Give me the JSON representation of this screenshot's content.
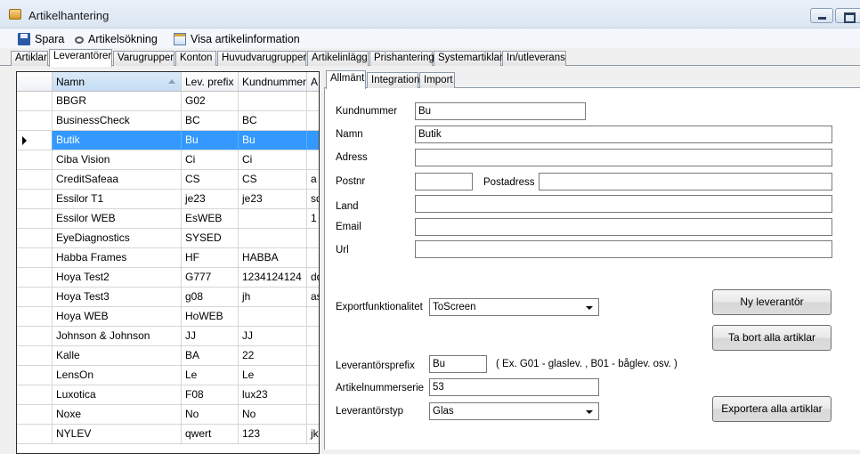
{
  "window": {
    "title": "Artikelhantering"
  },
  "toolbar": {
    "save_label": "Spara",
    "search_label": "Artikelsökning",
    "info_label": "Visa artikelinformation"
  },
  "main_tabs": [
    {
      "label": "Artiklar"
    },
    {
      "label": "Leverantörer"
    },
    {
      "label": "Varugrupper"
    },
    {
      "label": "Konton"
    },
    {
      "label": "Huvudvarugrupper"
    },
    {
      "label": "Artikelinlägg"
    },
    {
      "label": "Prishantering"
    },
    {
      "label": "Systemartiklar"
    },
    {
      "label": "In/utleverans"
    }
  ],
  "grid": {
    "columns": [
      "Namn",
      "Lev. prefix",
      "Kundnummer",
      "A"
    ],
    "rows": [
      [
        "BBGR",
        "G02",
        "",
        ""
      ],
      [
        "BusinessCheck",
        "BC",
        "BC",
        ""
      ],
      [
        "Butik",
        "Bu",
        "Bu",
        ""
      ],
      [
        "Ciba Vision",
        "Ci",
        "Ci",
        ""
      ],
      [
        "CreditSafeaa",
        "CS",
        "CS",
        "a"
      ],
      [
        "Essilor T1",
        "je23",
        "je23",
        "sdf"
      ],
      [
        "Essilor WEB",
        "EsWEB",
        "",
        "1"
      ],
      [
        "EyeDiagnostics",
        "SYSED",
        "",
        ""
      ],
      [
        "Habba Frames",
        "HF",
        "HABBA",
        ""
      ],
      [
        "Hoya Test2",
        "G777",
        "1234124124",
        "dd"
      ],
      [
        "Hoya Test3",
        "g08",
        "jh",
        "asd"
      ],
      [
        "Hoya WEB",
        "HoWEB",
        "",
        ""
      ],
      [
        "Johnson & Johnson",
        "JJ",
        "JJ",
        ""
      ],
      [
        "Kalle",
        "BA",
        "22",
        ""
      ],
      [
        "LensOn",
        "Le",
        "Le",
        ""
      ],
      [
        "Luxotica",
        "F08",
        "lux23",
        ""
      ],
      [
        "Noxe",
        "No",
        "No",
        ""
      ],
      [
        "NYLEV",
        "qwert",
        "123",
        "jks"
      ]
    ]
  },
  "detail_tabs": [
    {
      "label": "Allmänt"
    },
    {
      "label": "Integration"
    },
    {
      "label": "Import"
    }
  ],
  "form": {
    "kundnummer_label": "Kundnummer",
    "kundnummer_value": "Bu",
    "namn_label": "Namn",
    "namn_value": "Butik",
    "adress_label": "Adress",
    "adress_value": "",
    "postnr_label": "Postnr",
    "postnr_value": "",
    "postadress_label": "Postadress",
    "postadress_value": "",
    "land_label": "Land",
    "land_value": "",
    "email_label": "Email",
    "email_value": "",
    "url_label": "Url",
    "url_value": "",
    "export_label": "Exportfunktionalitet",
    "export_value": "ToScreen",
    "prefix_label": "Leverantörsprefix",
    "prefix_value": "Bu",
    "prefix_hint": "( Ex. G01 - glaslev. , B01 - båglev. osv. )",
    "serie_label": "Artikelnummerserie",
    "serie_value": "53",
    "typ_label": "Leverantörstyp",
    "typ_value": "Glas"
  },
  "buttons": {
    "new_supplier": "Ny leverantör",
    "remove_all": "Ta bort alla artiklar",
    "export_all": "Exportera alla artiklar"
  }
}
